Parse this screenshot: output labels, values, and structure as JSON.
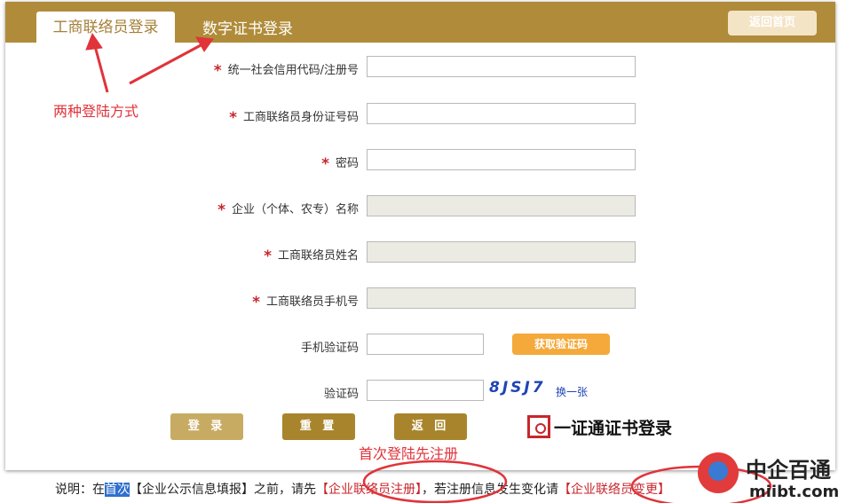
{
  "header": {
    "tab_active": "工商联络员登录",
    "tab_cert": "数字证书登录",
    "back_home": "返回首页"
  },
  "form": {
    "star": "*",
    "fields": [
      {
        "label": "统一社会信用代码/注册号",
        "required": true
      },
      {
        "label": "工商联络员身份证号码",
        "required": true
      },
      {
        "label": "密码",
        "required": true
      },
      {
        "label": "企业（个体、农专）名称",
        "required": true
      },
      {
        "label": "工商联络员姓名",
        "required": true
      },
      {
        "label": "工商联络员手机号",
        "required": true
      },
      {
        "label": "手机验证码",
        "required": false
      },
      {
        "label": "验证码",
        "required": false
      }
    ],
    "get_code": "获取验证码",
    "captcha": "8JSJ7",
    "refresh": "换一张",
    "login": "登 录",
    "reset": "重 置",
    "back": "返 回",
    "cert_login": "一证通证书登录"
  },
  "annotations": {
    "two_methods": "两种登陆方式",
    "register_first": "首次登陆先注册"
  },
  "note": {
    "prefix": "说明：在",
    "highlight": "首次",
    "middle": "【企业公示信息填报】之前，请先",
    "link1": "【企业联络员注册】",
    "suffix": "，若注册信息发生变化请",
    "link2": "【企业联络员变更】"
  },
  "watermark": {
    "name": "中企百通",
    "url": "miibt.com"
  }
}
